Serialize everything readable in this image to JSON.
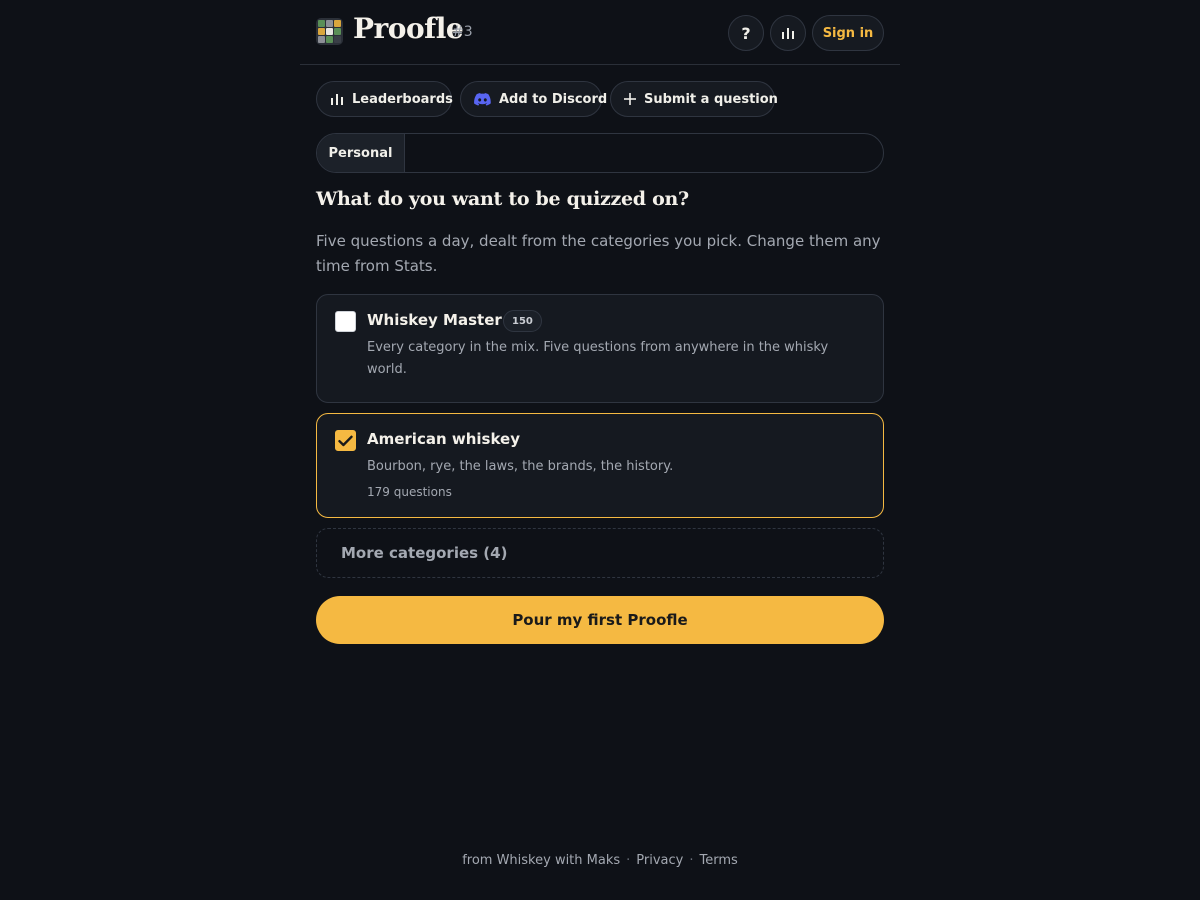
{
  "header": {
    "brand": "Proofle",
    "puzzle_number": "#3",
    "help_label": "?",
    "signin_label": "Sign in",
    "logo_icon": "grid-logo-icon",
    "stats_icon": "bar-chart-icon"
  },
  "actions": {
    "leaderboards_label": "Leaderboards",
    "discord_label": "Add to Discord",
    "submit_label": "Submit a question"
  },
  "tabs": {
    "personal_label": "Personal"
  },
  "main": {
    "heading": "What do you want to be quizzed on?",
    "intro": "Five questions a day, dealt from the categories you pick. Change them any time from Stats."
  },
  "categories": [
    {
      "title": "Whiskey Master",
      "badge": "150",
      "description": "Every category in the mix. Five questions from anywhere in the whisky world.",
      "checked": false
    },
    {
      "title": "American whiskey",
      "description": "Bourbon, rye, the laws, the brands, the history.",
      "meta": "179 questions",
      "checked": true
    }
  ],
  "more_label": "More categories (4)",
  "cta_label": "Pour my first Proofle",
  "footer": {
    "credit": "from Whiskey with Maks",
    "privacy": "Privacy",
    "terms": "Terms"
  },
  "colors": {
    "accent": "#f5b942",
    "background": "#0e1117",
    "card": "#151920",
    "discord": "#5865f2"
  }
}
